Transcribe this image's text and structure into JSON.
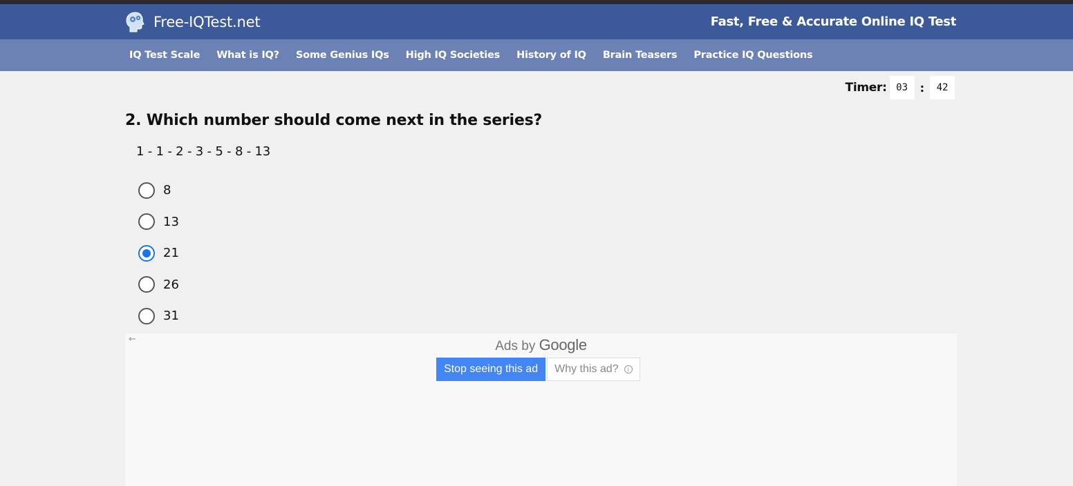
{
  "header": {
    "brand_name": "Free-IQTest.net",
    "tagline": "Fast, Free & Accurate Online IQ Test",
    "logo_icon": "brain-gears-icon"
  },
  "nav": {
    "items": [
      {
        "label": "IQ Test Scale"
      },
      {
        "label": "What is IQ?"
      },
      {
        "label": "Some Genius IQs"
      },
      {
        "label": "High IQ Societies"
      },
      {
        "label": "History of IQ"
      },
      {
        "label": "Brain Teasers"
      },
      {
        "label": "Practice IQ Questions"
      }
    ]
  },
  "timer": {
    "label": "Timer:",
    "minutes": "03",
    "separator": ":",
    "seconds": "42"
  },
  "question": {
    "title": "2. Which number should come next in the series?",
    "series": "1 - 1 - 2 - 3 - 5 - 8 - 13",
    "options": [
      {
        "label": "8",
        "selected": false
      },
      {
        "label": "13",
        "selected": false
      },
      {
        "label": "21",
        "selected": true
      },
      {
        "label": "26",
        "selected": false
      },
      {
        "label": "31",
        "selected": false
      }
    ]
  },
  "ad": {
    "back_arrow": "←",
    "ads_by": "Ads by",
    "google": "Google",
    "stop_label": "Stop seeing this ad",
    "why_label": "Why this ad?",
    "info_glyph": "i"
  },
  "colors": {
    "header_bg": "#3c5a9a",
    "subnav_bg": "#6c82b4",
    "radio_accent": "#1a73e8",
    "ad_button": "#4285f4"
  }
}
